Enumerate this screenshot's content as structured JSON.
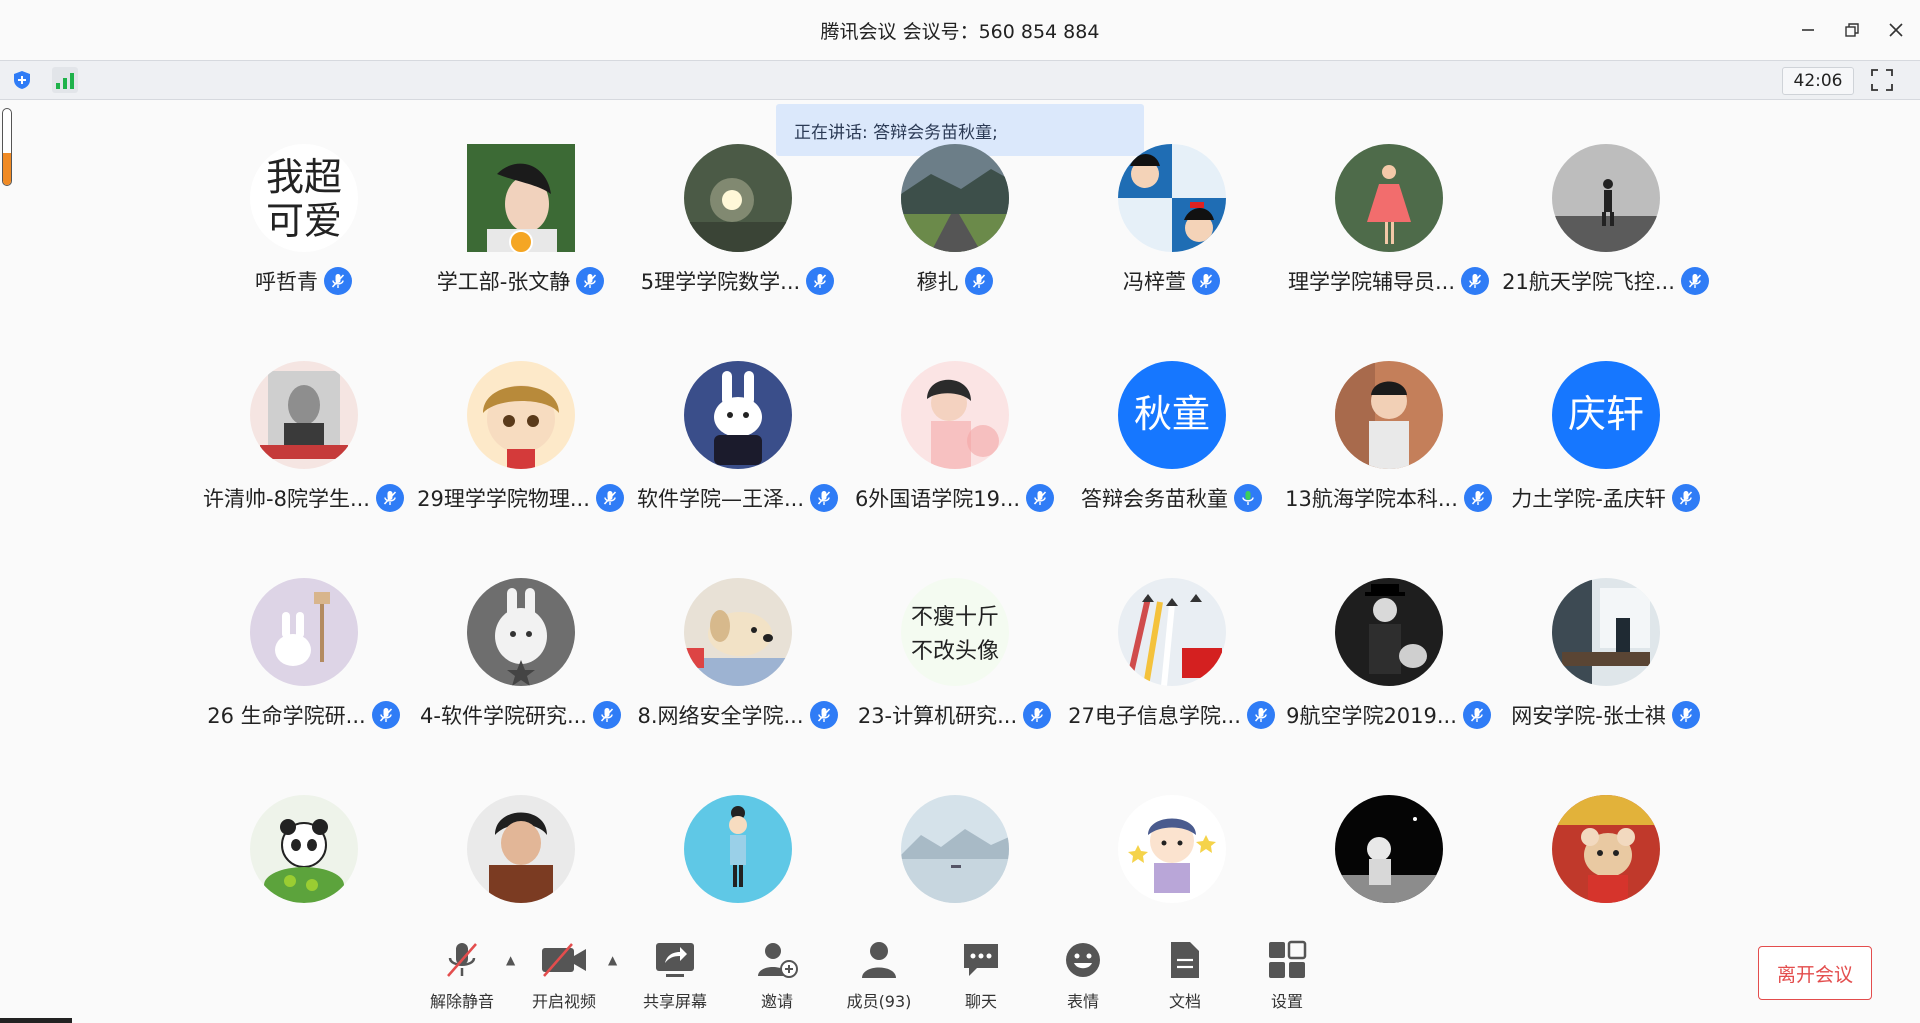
{
  "title": "腾讯会议 会议号：560 854 884",
  "timer": "42:06",
  "speaking": "正在讲话: 答辩会务苗秋童;",
  "colors": {
    "accent": "#2f7cf6",
    "leave": "#e34d4d",
    "signal": "#1fb24a",
    "volume": "#f08a24"
  },
  "audio_level": 0.42,
  "participants": [
    {
      "name": "呼哲青",
      "avatar": "text-我超可爱"
    },
    {
      "name": "学工部-张文静",
      "avatar": "photo-girl"
    },
    {
      "name": "5理学学院数学...",
      "avatar": "photo-light"
    },
    {
      "name": "穆扎",
      "avatar": "photo-road"
    },
    {
      "name": "冯梓萱",
      "avatar": "cartoon-quad"
    },
    {
      "name": "理学学院辅导员...",
      "avatar": "photo-dress"
    },
    {
      "name": "21航天学院飞控...",
      "avatar": "photo-walker"
    },
    {
      "name": "许清帅-8院学生...",
      "avatar": "photo-portrait"
    },
    {
      "name": "29理学学院物理...",
      "avatar": "cartoon-boy"
    },
    {
      "name": "软件学院—王泽...",
      "avatar": "cartoon-rabbit"
    },
    {
      "name": "6外国语学院19...",
      "avatar": "cartoon-girl"
    },
    {
      "name": "答辩会务苗秋童",
      "avatar": "text-秋童",
      "avatar_text": "秋童"
    },
    {
      "name": "13航海学院本科...",
      "avatar": "photo-child"
    },
    {
      "name": "力土学院-孟庆轩",
      "avatar": "text-庆轩",
      "avatar_text": "庆轩"
    },
    {
      "name": "26 生命学院研...",
      "avatar": "cartoon-bunny"
    },
    {
      "name": "4-软件学院研究...",
      "avatar": "cartoon-bw-rabbit"
    },
    {
      "name": "8.网络安全学院...",
      "avatar": "photo-puppy"
    },
    {
      "name": "23-计算机研究...",
      "avatar": "text-不瘦十斤不改头像"
    },
    {
      "name": "27电子信息学院...",
      "avatar": "photo-jets"
    },
    {
      "name": "9航空学院2019...",
      "avatar": "photo-chaplin"
    },
    {
      "name": "网安学院-张士祺",
      "avatar": "photo-window"
    },
    {
      "name": "",
      "avatar": "cartoon-panda"
    },
    {
      "name": "",
      "avatar": "photo-man"
    },
    {
      "name": "",
      "avatar": "cartoon-figure"
    },
    {
      "name": "",
      "avatar": "photo-lake"
    },
    {
      "name": "",
      "avatar": "cartoon-kid"
    },
    {
      "name": "",
      "avatar": "photo-astronaut"
    },
    {
      "name": "",
      "avatar": "cartoon-rat"
    }
  ],
  "avatar_texts": {
    "t1": "我超",
    "t2": "可爱",
    "t3": "不瘦十斤",
    "t4": "不改头像"
  },
  "bottom": {
    "mute": "解除静音",
    "video": "开启视频",
    "share": "共享屏幕",
    "invite": "邀请",
    "members": "成员(93)",
    "chat": "聊天",
    "emoji": "表情",
    "docs": "文档",
    "settings": "设置",
    "leave": "离开会议"
  }
}
